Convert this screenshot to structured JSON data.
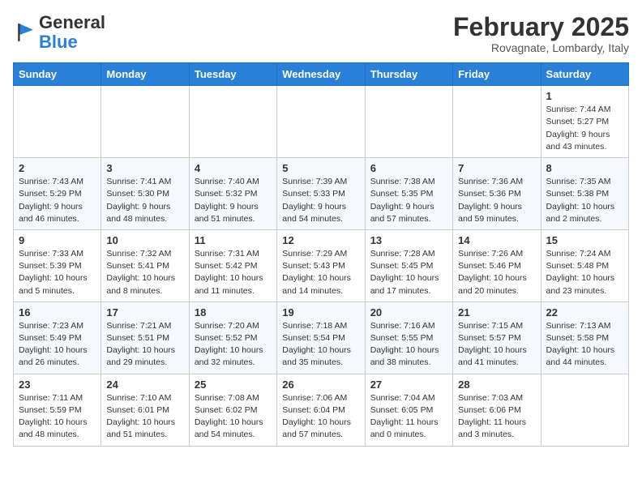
{
  "header": {
    "logo_general": "General",
    "logo_blue": "Blue",
    "month_title": "February 2025",
    "subtitle": "Rovagnate, Lombardy, Italy"
  },
  "weekdays": [
    "Sunday",
    "Monday",
    "Tuesday",
    "Wednesday",
    "Thursday",
    "Friday",
    "Saturday"
  ],
  "weeks": [
    [
      {
        "day": null,
        "info": null
      },
      {
        "day": null,
        "info": null
      },
      {
        "day": null,
        "info": null
      },
      {
        "day": null,
        "info": null
      },
      {
        "day": null,
        "info": null
      },
      {
        "day": null,
        "info": null
      },
      {
        "day": "1",
        "info": "Sunrise: 7:44 AM\nSunset: 5:27 PM\nDaylight: 9 hours and 43 minutes."
      }
    ],
    [
      {
        "day": "2",
        "info": "Sunrise: 7:43 AM\nSunset: 5:29 PM\nDaylight: 9 hours and 46 minutes."
      },
      {
        "day": "3",
        "info": "Sunrise: 7:41 AM\nSunset: 5:30 PM\nDaylight: 9 hours and 48 minutes."
      },
      {
        "day": "4",
        "info": "Sunrise: 7:40 AM\nSunset: 5:32 PM\nDaylight: 9 hours and 51 minutes."
      },
      {
        "day": "5",
        "info": "Sunrise: 7:39 AM\nSunset: 5:33 PM\nDaylight: 9 hours and 54 minutes."
      },
      {
        "day": "6",
        "info": "Sunrise: 7:38 AM\nSunset: 5:35 PM\nDaylight: 9 hours and 57 minutes."
      },
      {
        "day": "7",
        "info": "Sunrise: 7:36 AM\nSunset: 5:36 PM\nDaylight: 9 hours and 59 minutes."
      },
      {
        "day": "8",
        "info": "Sunrise: 7:35 AM\nSunset: 5:38 PM\nDaylight: 10 hours and 2 minutes."
      }
    ],
    [
      {
        "day": "9",
        "info": "Sunrise: 7:33 AM\nSunset: 5:39 PM\nDaylight: 10 hours and 5 minutes."
      },
      {
        "day": "10",
        "info": "Sunrise: 7:32 AM\nSunset: 5:41 PM\nDaylight: 10 hours and 8 minutes."
      },
      {
        "day": "11",
        "info": "Sunrise: 7:31 AM\nSunset: 5:42 PM\nDaylight: 10 hours and 11 minutes."
      },
      {
        "day": "12",
        "info": "Sunrise: 7:29 AM\nSunset: 5:43 PM\nDaylight: 10 hours and 14 minutes."
      },
      {
        "day": "13",
        "info": "Sunrise: 7:28 AM\nSunset: 5:45 PM\nDaylight: 10 hours and 17 minutes."
      },
      {
        "day": "14",
        "info": "Sunrise: 7:26 AM\nSunset: 5:46 PM\nDaylight: 10 hours and 20 minutes."
      },
      {
        "day": "15",
        "info": "Sunrise: 7:24 AM\nSunset: 5:48 PM\nDaylight: 10 hours and 23 minutes."
      }
    ],
    [
      {
        "day": "16",
        "info": "Sunrise: 7:23 AM\nSunset: 5:49 PM\nDaylight: 10 hours and 26 minutes."
      },
      {
        "day": "17",
        "info": "Sunrise: 7:21 AM\nSunset: 5:51 PM\nDaylight: 10 hours and 29 minutes."
      },
      {
        "day": "18",
        "info": "Sunrise: 7:20 AM\nSunset: 5:52 PM\nDaylight: 10 hours and 32 minutes."
      },
      {
        "day": "19",
        "info": "Sunrise: 7:18 AM\nSunset: 5:54 PM\nDaylight: 10 hours and 35 minutes."
      },
      {
        "day": "20",
        "info": "Sunrise: 7:16 AM\nSunset: 5:55 PM\nDaylight: 10 hours and 38 minutes."
      },
      {
        "day": "21",
        "info": "Sunrise: 7:15 AM\nSunset: 5:57 PM\nDaylight: 10 hours and 41 minutes."
      },
      {
        "day": "22",
        "info": "Sunrise: 7:13 AM\nSunset: 5:58 PM\nDaylight: 10 hours and 44 minutes."
      }
    ],
    [
      {
        "day": "23",
        "info": "Sunrise: 7:11 AM\nSunset: 5:59 PM\nDaylight: 10 hours and 48 minutes."
      },
      {
        "day": "24",
        "info": "Sunrise: 7:10 AM\nSunset: 6:01 PM\nDaylight: 10 hours and 51 minutes."
      },
      {
        "day": "25",
        "info": "Sunrise: 7:08 AM\nSunset: 6:02 PM\nDaylight: 10 hours and 54 minutes."
      },
      {
        "day": "26",
        "info": "Sunrise: 7:06 AM\nSunset: 6:04 PM\nDaylight: 10 hours and 57 minutes."
      },
      {
        "day": "27",
        "info": "Sunrise: 7:04 AM\nSunset: 6:05 PM\nDaylight: 11 hours and 0 minutes."
      },
      {
        "day": "28",
        "info": "Sunrise: 7:03 AM\nSunset: 6:06 PM\nDaylight: 11 hours and 3 minutes."
      },
      {
        "day": null,
        "info": null
      }
    ]
  ]
}
